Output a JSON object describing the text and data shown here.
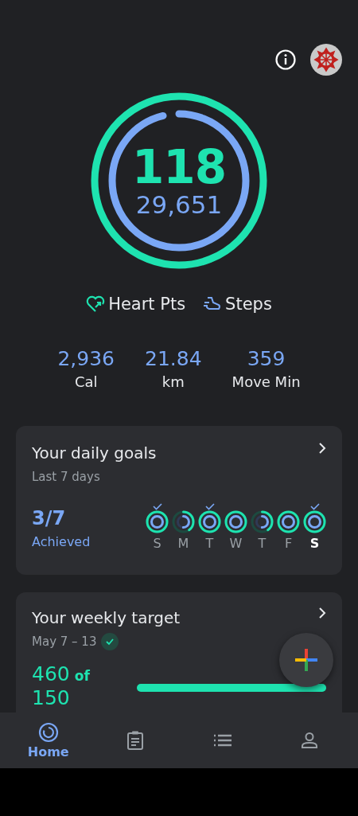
{
  "summary": {
    "heart_points": "118",
    "steps": "29,651"
  },
  "legend": [
    {
      "label": "Heart Pts",
      "kind": "heart"
    },
    {
      "label": "Steps",
      "kind": "steps"
    }
  ],
  "stats": [
    {
      "value": "2,936",
      "label": "Cal"
    },
    {
      "value": "21.84",
      "label": "km"
    },
    {
      "value": "359",
      "label": "Move Min"
    }
  ],
  "daily_goals": {
    "title": "Your daily goals",
    "subtitle": "Last 7 days",
    "count": "3/7",
    "count_label": "Achieved",
    "days": [
      {
        "letter": "S",
        "kind": "full",
        "checked": true,
        "selected": false
      },
      {
        "letter": "M",
        "kind": "partial",
        "checked": false,
        "selected": false
      },
      {
        "letter": "T",
        "kind": "full",
        "checked": true,
        "selected": false
      },
      {
        "letter": "W",
        "kind": "full",
        "checked": false,
        "selected": false
      },
      {
        "letter": "T",
        "kind": "partial",
        "checked": false,
        "selected": false
      },
      {
        "letter": "F",
        "kind": "full",
        "checked": false,
        "selected": false
      },
      {
        "letter": "S",
        "kind": "full",
        "checked": true,
        "selected": true
      }
    ]
  },
  "weekly_target": {
    "title": "Your weekly target",
    "dates": "May 7 – 13",
    "achieved": true,
    "value": "460",
    "of": "of",
    "target": "150",
    "level": 1
  },
  "nav": [
    {
      "kind": "home",
      "label": "Home",
      "selected": true
    },
    {
      "kind": "journal",
      "selected": false
    },
    {
      "kind": "browse",
      "selected": false
    },
    {
      "kind": "profile",
      "selected": false
    }
  ]
}
